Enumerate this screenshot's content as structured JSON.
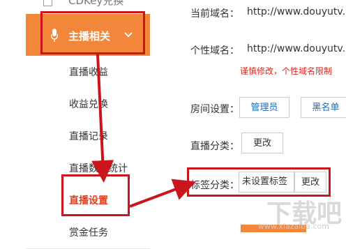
{
  "sidebar": {
    "cdkey_label": "CDKey兑换",
    "active_menu": {
      "label": "主播相关",
      "icon": "microphone-icon",
      "chevron": "chevron-down-icon"
    },
    "items": [
      {
        "label": "直播收益"
      },
      {
        "label": "收益兑换"
      },
      {
        "label": "直播记录"
      },
      {
        "label": "直播数据统计"
      },
      {
        "label": "直播设置"
      },
      {
        "label": "赏金任务"
      }
    ]
  },
  "main": {
    "current_domain_label": "当前域名：",
    "current_domain_value": "http://www.douyutv.",
    "custom_domain_label": "个性域名：",
    "custom_domain_value": "http://www.douyutv.",
    "warning": "谨慎修改，个性域名限制",
    "room_settings_label": "房间设置：",
    "admin_button": "管理员",
    "blacklist_button": "黑名单",
    "live_category_label": "直播分类：",
    "category_change_button": "更改",
    "tag_category_label": "标签分类：",
    "tag_value": "未设置标签",
    "tag_change_button": "更改"
  },
  "watermark": {
    "logo": "下载吧",
    "url": "www.xiazaiba.com"
  },
  "colors": {
    "accent": "#f2873b",
    "annotation_red": "#c9151b",
    "warning": "#e1251b",
    "link": "#1e6bb8"
  }
}
